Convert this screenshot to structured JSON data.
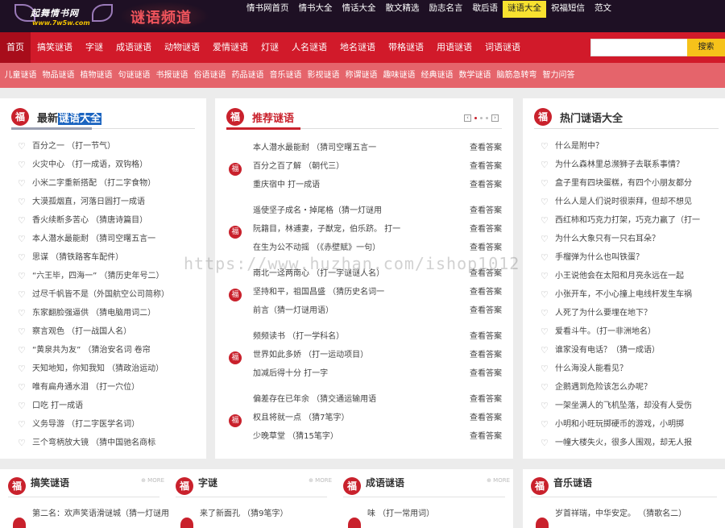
{
  "site": {
    "logo_text": "起舞情书网",
    "logo_url": "www.7w5w.com",
    "channel_title": "谜语频道"
  },
  "topnav": [
    {
      "label": "情书网首页"
    },
    {
      "label": "情书大全"
    },
    {
      "label": "情话大全"
    },
    {
      "label": "散文精选"
    },
    {
      "label": "励志名言"
    },
    {
      "label": "歇后语"
    },
    {
      "label": "谜语大全",
      "current": true
    },
    {
      "label": "祝福短信"
    },
    {
      "label": "范文"
    }
  ],
  "mainnav": [
    {
      "label": "首页",
      "current": true
    },
    {
      "label": "搞笑谜语"
    },
    {
      "label": "字谜"
    },
    {
      "label": "成语谜语"
    },
    {
      "label": "动物谜语"
    },
    {
      "label": "爱情谜语"
    },
    {
      "label": "灯谜"
    },
    {
      "label": "人名谜语"
    },
    {
      "label": "地名谜语"
    },
    {
      "label": "带格谜语"
    },
    {
      "label": "用语谜语"
    },
    {
      "label": "词语谜语"
    }
  ],
  "search": {
    "placeholder": "",
    "button": "搜索"
  },
  "subnav": [
    "儿童谜语",
    "物品谜语",
    "植物谜语",
    "句谜谜语",
    "书报谜语",
    "俗语谜语",
    "药品谜语",
    "音乐谜语",
    "影视谜语",
    "称谓谜语",
    "趣味谜语",
    "经典谜语",
    "数学谜语",
    "脑筋急转弯",
    "智力问答"
  ],
  "latest": {
    "seal": "福",
    "title_pre": "最新",
    "title_hl": "谜语大全",
    "items": [
      "百分之一 （打一节气）",
      "火灾中心 （打一成语，双钩格）",
      "小米二字重新搭配 （打二字食物）",
      "大漠孤烟直，河落日圆打一成语",
      "香火续断多苦心 （猜唐诗篇目）",
      "本人潜水最能耐 （猜司空曙五言一",
      "思谋 （猜铁路客车配件）",
      "“六王毕，四海一” （猜历史年号二）",
      "过尽千帆皆不是（外国航空公司简称）",
      "东家翻脸强逼供 （猜电脑用词二）",
      "察言观色 （打一战国人名）",
      "“黄泉共为友” （猜治安名词 卷帘",
      "天知地知，你知我知 （猜政治运动）",
      "唯有扁舟通水泪 （打一穴位）",
      "口吃 打一成语",
      "义务导游 （打二字医学名词）",
      "三个弯柄放大镜 （猜中国驰名商标"
    ]
  },
  "recommend": {
    "seal": "福",
    "title": "推荐谜语",
    "answer_label": "查看答案",
    "groups": [
      [
        "本人潜水最能耐 （猜司空曙五言一",
        "百分之百了解 （朝代三）",
        "重庆宿中 打一成语"
      ],
      [
        "遥使坚子成名・掉尾格（猜一灯谜用",
        "阮籍目，林逋妻，子猷宠，伯乐跻。 打一",
        "在生为公不动摇 （《赤壁赋》一句）"
      ],
      [
        "南北一迳两南心 （打一字谜谜人名）",
        "坚持和平，祖国昌盛 （猜历史名词一",
        "前言（猜一灯谜用语）"
      ],
      [
        "频频读书 （打一学科名）",
        "世界如此多娇 （打一运动项目）",
        "加减后得十分 打一字"
      ],
      [
        "偏差存在已年余 （猜交通运输用语",
        "权且将就一点 （猜7笔字）",
        "少晚草堂 （猜15笔字）"
      ]
    ]
  },
  "hot": {
    "seal": "福",
    "title": "热门谜语大全",
    "items": [
      "什么是附中？",
      "为什么森林里总濒狮子去联系事情？",
      "盒子里有四块蛋糕，有四个小朋友都分",
      "什么人是人们说时很崇拜，但却不想见",
      "西红柿和巧克力打架，巧克力赢了（打一",
      "为什么大象只有一只右耳朵？",
      "手榴弹为什么也叫铁蛋？",
      "小王说他会在太阳和月亮永远在一起",
      "小张开车，不小心撞上电线杆发生车祸",
      "人死了为什么要埋在地下？",
      "爱看斗牛。（打一非洲地名）",
      "谁家没有电话？（猜一成语）",
      "什么海没人能看见？",
      "企鹅遇到危险该怎么办呢？",
      "一架坐满人的飞机坠落，却没有人受伤",
      "小明和小旺玩掷硬币的游戏，小明掷",
      "一幢大楼失火，很多人围观，却无人报"
    ]
  },
  "bottom": [
    {
      "seal": "福",
      "title": "搞笑谜语",
      "more": "MORE",
      "first": "第二名：欢声笑语滑谜城（猜一灯谜用"
    },
    {
      "seal": "福",
      "title": "字谜",
      "more": "MORE",
      "first": "来了新面孔 （猜9笔字）"
    },
    {
      "seal": "福",
      "title": "成语谜语",
      "more": "MORE",
      "first": "味 （打一常用词）"
    },
    {
      "seal": "福",
      "title": "音乐谜语",
      "more": "",
      "first": "岁首祥瑞，中华安定。 （猜歌名二）"
    }
  ],
  "watermark": "https://www.huzhan.com/ishop1012"
}
